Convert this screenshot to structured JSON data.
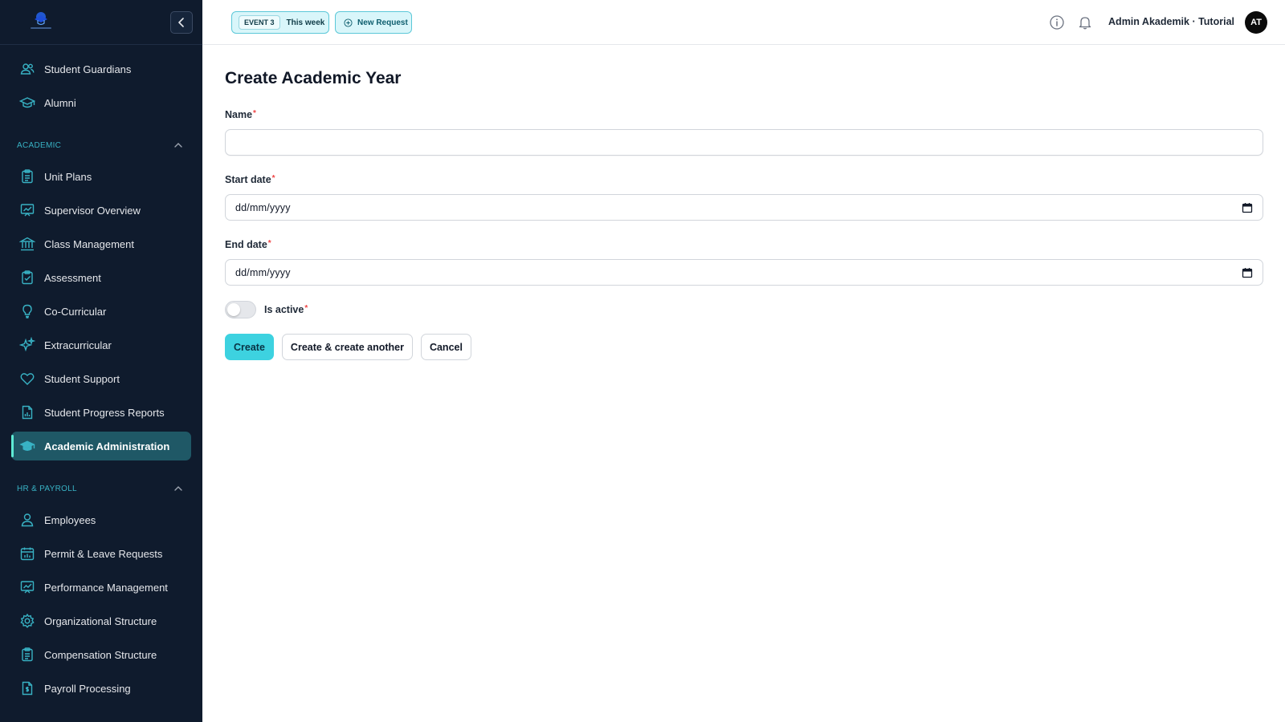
{
  "colors": {
    "sidebar_bg": "#0f1b2d",
    "active_bg": "#1f5866",
    "accent": "#3dd2e0",
    "required": "#ef4444",
    "group_heading": "#38b2c4"
  },
  "sidebar": {
    "items_top": [
      {
        "label": "Student Guardians",
        "icon": "users-icon"
      },
      {
        "label": "Alumni",
        "icon": "graduation-cap-icon"
      }
    ],
    "groups": [
      {
        "title": "ACADEMIC",
        "expanded": true,
        "items": [
          {
            "label": "Unit Plans",
            "icon": "clipboard-icon"
          },
          {
            "label": "Supervisor Overview",
            "icon": "presentation-chart-icon"
          },
          {
            "label": "Class Management",
            "icon": "building-columns-icon"
          },
          {
            "label": "Assessment",
            "icon": "clipboard-check-icon"
          },
          {
            "label": "Co-Curricular",
            "icon": "lightbulb-icon"
          },
          {
            "label": "Extracurricular",
            "icon": "sparkles-icon"
          },
          {
            "label": "Student Support",
            "icon": "heart-icon"
          },
          {
            "label": "Student Progress Reports",
            "icon": "document-chart-icon"
          },
          {
            "label": "Academic Administration",
            "icon": "academic-cap-icon",
            "active": true
          }
        ]
      },
      {
        "title": "HR & PAYROLL",
        "expanded": true,
        "items": [
          {
            "label": "Employees",
            "icon": "user-icon"
          },
          {
            "label": "Permit & Leave Requests",
            "icon": "calendar-chart-icon"
          },
          {
            "label": "Performance Management",
            "icon": "presentation-chart-icon"
          },
          {
            "label": "Organizational Structure",
            "icon": "gear-icon"
          },
          {
            "label": "Compensation Structure",
            "icon": "clipboard-icon"
          },
          {
            "label": "Payroll Processing",
            "icon": "document-dollar-icon"
          }
        ]
      }
    ]
  },
  "topbar": {
    "event_badge": "EVENT 3",
    "event_period": "This week",
    "new_request": "New Request",
    "user_name": "Admin Akademik · Tutorial",
    "avatar_initials": "AT"
  },
  "form": {
    "title": "Create Academic Year",
    "name_label": "Name",
    "name_value": "",
    "start_label": "Start date",
    "start_placeholder": "dd/mm/yyyy",
    "end_label": "End date",
    "end_placeholder": "dd/mm/yyyy",
    "active_label": "Is active",
    "active_value": false,
    "required_mark": "*",
    "create_label": "Create",
    "create_another_label": "Create & create another",
    "cancel_label": "Cancel"
  }
}
